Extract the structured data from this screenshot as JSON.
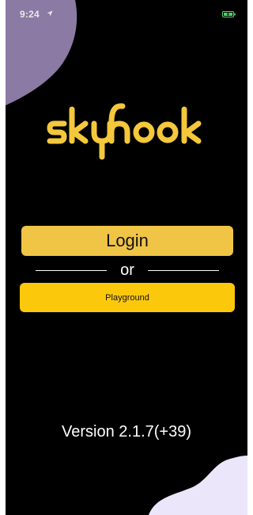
{
  "status_bar": {
    "time": "9:24",
    "location_icon": "location-arrow-icon",
    "battery_icon": "battery-charging-icon"
  },
  "logo": {
    "text": "skyhook"
  },
  "login": {
    "label": "Login"
  },
  "divider": {
    "label": "or"
  },
  "playground": {
    "label": "Playground"
  },
  "footer": {
    "version": "Version 2.1.7(+39)"
  },
  "colors": {
    "brand_yellow": "#f5c83b",
    "login_button": "#f0c445",
    "playground_button": "#fcc80c",
    "background": "#000000",
    "blob_top": "#8a7aa4",
    "blob_bottom": "#ece6fb",
    "battery": "#4cd964"
  }
}
